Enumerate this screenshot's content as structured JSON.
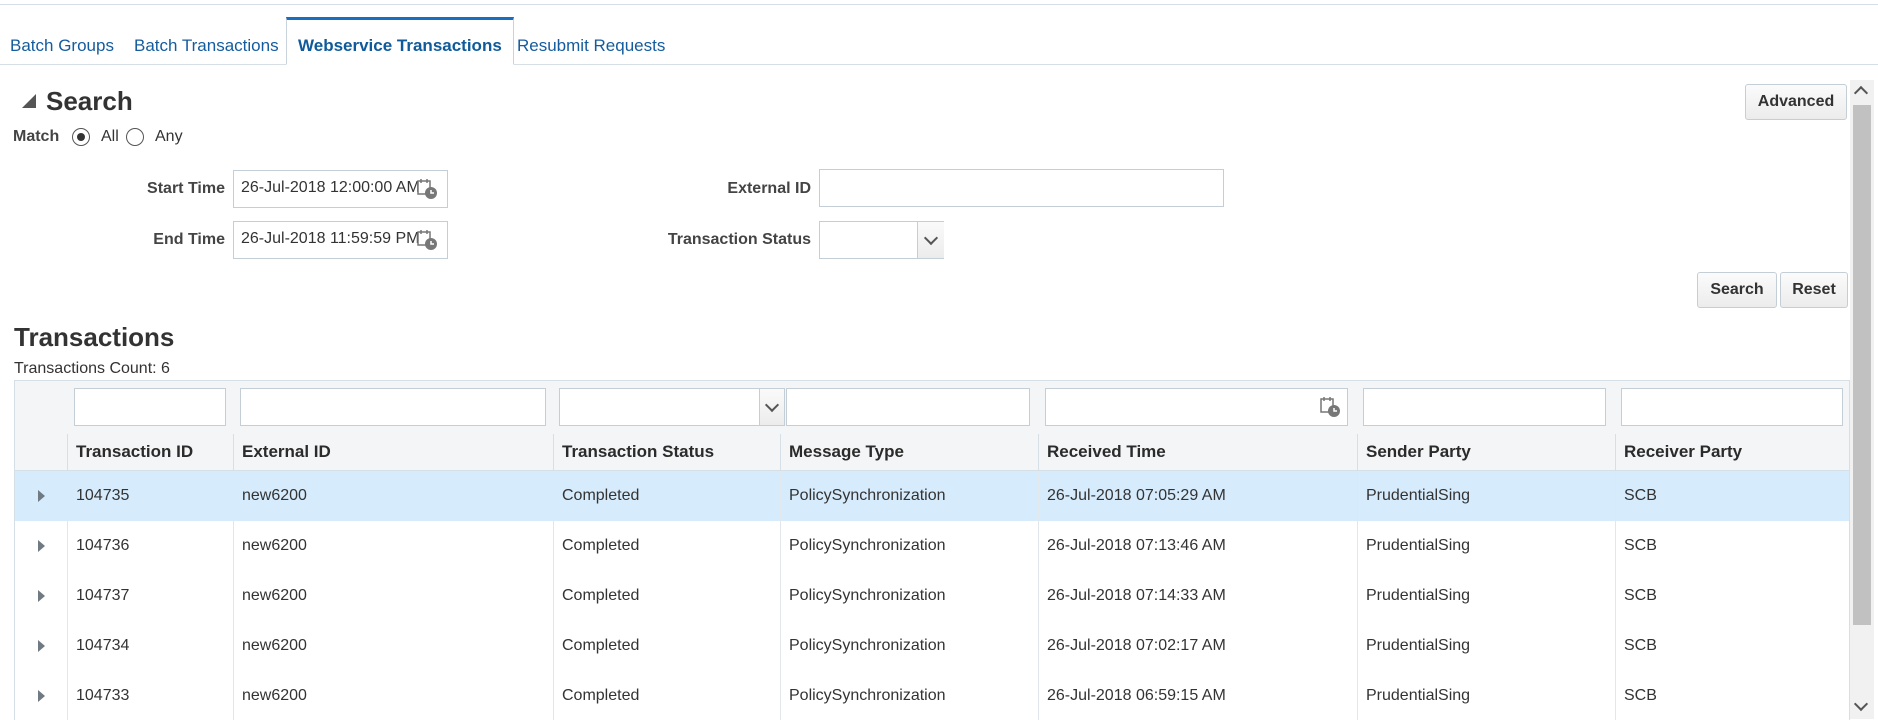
{
  "tabs": [
    {
      "label": "Batch Groups"
    },
    {
      "label": "Batch Transactions"
    },
    {
      "label": "Webservice Transactions"
    },
    {
      "label": "Resubmit Requests"
    }
  ],
  "search": {
    "title": "Search",
    "advanced_label": "Advanced",
    "match_label": "Match",
    "match_all": "All",
    "match_any": "Any",
    "start_time_label": "Start Time",
    "start_time_value": "26-Jul-2018 12:00:00 AM",
    "end_time_label": "End Time",
    "end_time_value": "26-Jul-2018 11:59:59 PM",
    "external_id_label": "External ID",
    "external_id_value": "",
    "status_label": "Transaction Status",
    "status_value": "",
    "search_button": "Search",
    "reset_button": "Reset"
  },
  "transactions": {
    "title": "Transactions",
    "count_text": "Transactions Count: 6",
    "columns": [
      "Transaction ID",
      "External ID",
      "Transaction Status",
      "Message Type",
      "Received Time",
      "Sender Party",
      "Receiver Party"
    ],
    "rows": [
      {
        "id": "104735",
        "ext": "new6200",
        "status": "Completed",
        "type": "PolicySynchronization",
        "received": "26-Jul-2018 07:05:29 AM",
        "sender": "PrudentialSing",
        "receiver": "SCB"
      },
      {
        "id": "104736",
        "ext": "new6200",
        "status": "Completed",
        "type": "PolicySynchronization",
        "received": "26-Jul-2018 07:13:46 AM",
        "sender": "PrudentialSing",
        "receiver": "SCB"
      },
      {
        "id": "104737",
        "ext": "new6200",
        "status": "Completed",
        "type": "PolicySynchronization",
        "received": "26-Jul-2018 07:14:33 AM",
        "sender": "PrudentialSing",
        "receiver": "SCB"
      },
      {
        "id": "104734",
        "ext": "new6200",
        "status": "Completed",
        "type": "PolicySynchronization",
        "received": "26-Jul-2018 07:02:17 AM",
        "sender": "PrudentialSing",
        "receiver": "SCB"
      },
      {
        "id": "104733",
        "ext": "new6200",
        "status": "Completed",
        "type": "PolicySynchronization",
        "received": "26-Jul-2018 06:59:15 AM",
        "sender": "PrudentialSing",
        "receiver": "SCB"
      }
    ]
  },
  "icons": {
    "calendar": "calendar-clock-icon",
    "dropdown": "chevron-down-icon",
    "expand": "triangle-right-icon",
    "disclose": "triangle-down-icon"
  },
  "colors": {
    "link": "#145c9e",
    "selected_row": "#d6ebfc",
    "header_bg": "#f3f5f7"
  }
}
